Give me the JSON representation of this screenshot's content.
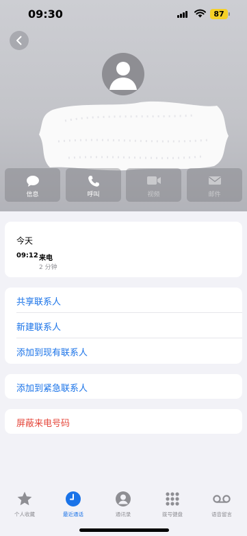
{
  "status_bar": {
    "time": "09:30",
    "battery": "87"
  },
  "actions": [
    {
      "label": "信息",
      "icon": "message-bubble-icon",
      "enabled": true
    },
    {
      "label": "呼叫",
      "icon": "phone-icon",
      "enabled": true
    },
    {
      "label": "视频",
      "icon": "video-camera-icon",
      "enabled": false
    },
    {
      "label": "邮件",
      "icon": "envelope-icon",
      "enabled": false
    }
  ],
  "recent_calls": {
    "day": "今天",
    "entries": [
      {
        "time": "09:12",
        "type": "来电",
        "duration": "2 分钟"
      }
    ]
  },
  "options": {
    "share_contact": "共享联系人",
    "new_contact": "新建联系人",
    "add_to_existing": "添加到现有联系人",
    "add_to_emergency": "添加到紧急联系人",
    "block_caller": "屏蔽来电号码"
  },
  "tabs": [
    {
      "label": "个人收藏",
      "icon": "star-icon",
      "active": false
    },
    {
      "label": "最近通话",
      "icon": "clock-icon",
      "active": true
    },
    {
      "label": "通讯录",
      "icon": "person-circle-icon",
      "active": false
    },
    {
      "label": "拨号键盘",
      "icon": "keypad-icon",
      "active": false
    },
    {
      "label": "语音留言",
      "icon": "voicemail-icon",
      "active": false
    }
  ],
  "colors": {
    "accent": "#1a73e8",
    "danger": "#e5483c",
    "battery": "#f5d027"
  }
}
